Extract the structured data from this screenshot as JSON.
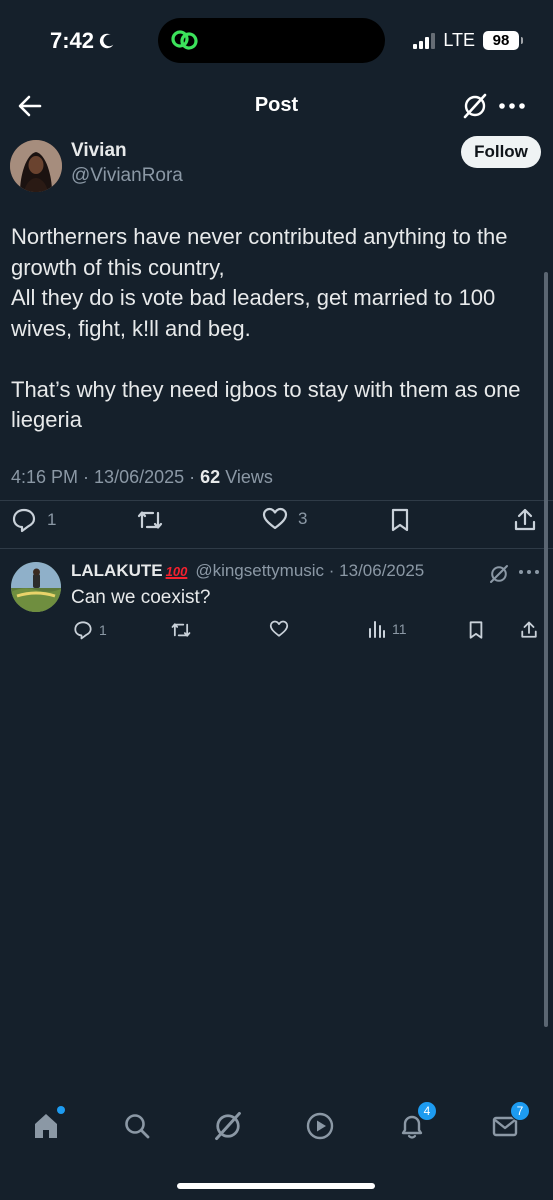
{
  "status_bar": {
    "time": "7:42",
    "network": "LTE",
    "battery": "98"
  },
  "header": {
    "title": "Post"
  },
  "post": {
    "author_name": "Vivian",
    "author_handle": "@VivianRora",
    "follow_label": "Follow",
    "text": "Northerners have never contributed anything to the growth of this country,\nAll they do is vote bad leaders, get married to 100 wives, fight, k!ll and beg.\n\nThat’s why they need igbos to stay with them as one liegeria",
    "time": "4:16 PM",
    "date": "13/06/2025",
    "views_count": "62",
    "views_label": "Views",
    "replies": "1",
    "likes": "3"
  },
  "reply": {
    "name": "LALAKUTE",
    "emoji": "100",
    "handle": "@kingsettymusic",
    "date": "13/06/2025",
    "text": "Can we coexist?",
    "replies": "1",
    "views": "11"
  },
  "bottom_nav": {
    "notifications_badge": "4",
    "messages_badge": "7"
  },
  "colors": {
    "background": "#15202b",
    "accent": "#1d9bf0",
    "muted": "#8b98a5"
  }
}
